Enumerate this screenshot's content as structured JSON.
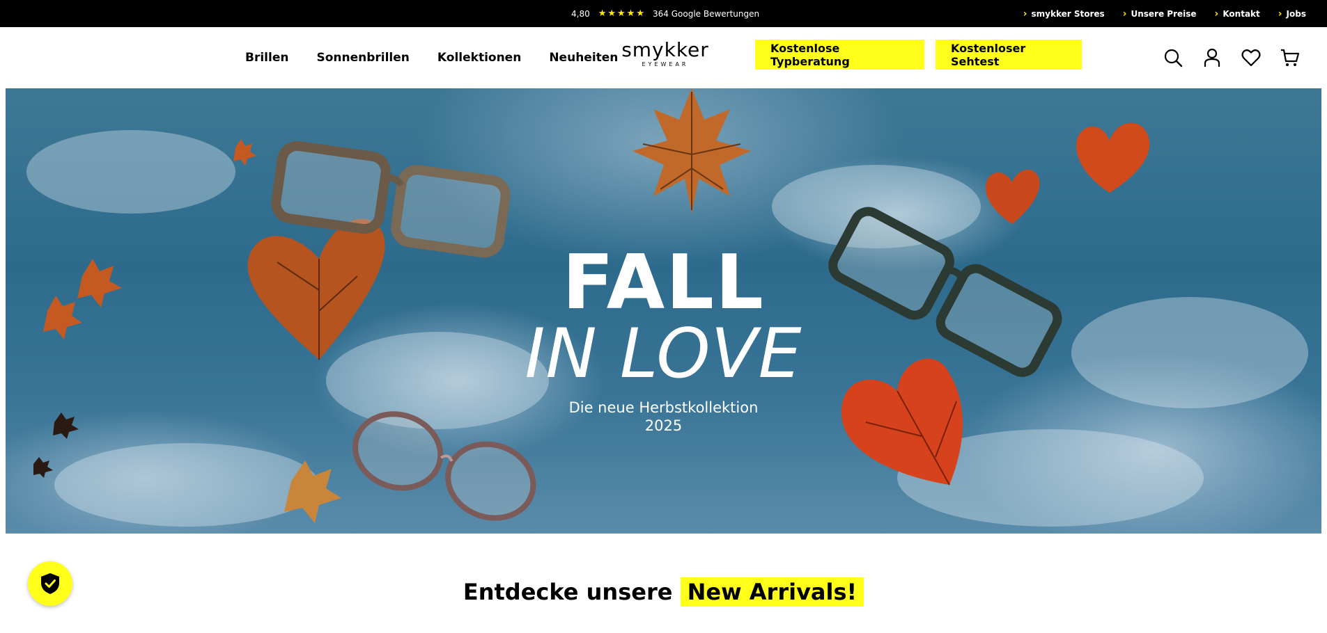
{
  "topbar": {
    "rating": "4,80",
    "stars": "★★★★★",
    "reviews": "364 Google Bewertungen",
    "links": [
      "smykker Stores",
      "Unsere Preise",
      "Kontakt",
      "Jobs"
    ]
  },
  "nav": {
    "items": [
      "Brillen",
      "Sonnenbrillen",
      "Kollektionen",
      "Neuheiten"
    ]
  },
  "logo": {
    "word": "smykker",
    "sub": "EYEWEAR"
  },
  "cta": {
    "typberatung": "Kostenlose Typberatung",
    "sehtest": "Kostenloser Sehtest"
  },
  "header_icons": [
    "search-icon",
    "account-icon",
    "wishlist-heart-icon",
    "cart-icon"
  ],
  "hero": {
    "title_line1": "FALL",
    "title_line2": "IN LOVE",
    "subtitle_line1": "Die neue Herbstkollektion",
    "subtitle_line2": "2025"
  },
  "section": {
    "title_prefix": "Entdecke unsere",
    "title_highlight": "New Arrivals!"
  },
  "colors": {
    "accent": "#ffff1a",
    "topbar": "#000000",
    "star": "#ffea00"
  }
}
